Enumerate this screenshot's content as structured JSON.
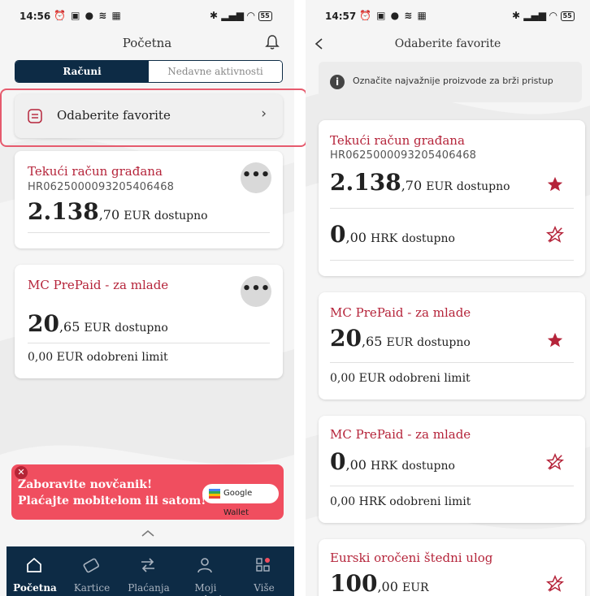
{
  "colors": {
    "brand_red": "#b5243a",
    "navy": "#0d2b45",
    "promo_red": "#f04e5f",
    "highlight": "#e65b6e"
  },
  "left": {
    "status": {
      "time": "14:56",
      "battery": "55"
    },
    "title": "Početna",
    "tabs": [
      {
        "label": "Računi",
        "active": true
      },
      {
        "label": "Nedavne aktivnosti",
        "active": false
      }
    ],
    "favorites_link": "Odaberite favorite",
    "accounts": [
      {
        "name": "Tekući račun građana",
        "iban": "HR0625000093205406468",
        "amount_big": "2.138",
        "amount_rest": ",70",
        "currency": "EUR",
        "status": "dostupno"
      },
      {
        "name": "MC PrePaid - za mlade",
        "amount_big": "20",
        "amount_rest": ",65",
        "currency": "EUR",
        "status": "dostupno",
        "limit": "0,00 EUR odobreni limit"
      }
    ],
    "more_icon": "•••",
    "promo": {
      "line1": "Zaboravite novčanik!",
      "line2": "Plaćajte mobitelom ili satom!",
      "wallet_label": "Google Wallet"
    },
    "nav": [
      {
        "label": "Početna",
        "icon": "home-icon",
        "active": true
      },
      {
        "label": "Kartice",
        "icon": "card-icon",
        "active": false
      },
      {
        "label": "Plaćanja",
        "icon": "transfer-icon",
        "active": false
      },
      {
        "label": "Moji podaci",
        "icon": "user-icon",
        "active": false
      },
      {
        "label": "Više",
        "icon": "grid-icon",
        "active": false
      }
    ]
  },
  "right": {
    "status": {
      "time": "14:57",
      "battery": "55"
    },
    "title": "Odaberite favorite",
    "info": "Označite najvažnije proizvode za brži pristup",
    "cards": [
      {
        "name": "Tekući račun građana",
        "iban": "HR0625000093205406468",
        "rows": [
          {
            "big": "2.138",
            "rest": ",70",
            "currency": "EUR",
            "status": "dostupno",
            "favorite": true
          },
          {
            "big": "0",
            "rest": ",00",
            "currency": "HRK",
            "status": "dostupno",
            "favorite": false
          }
        ]
      },
      {
        "name": "MC PrePaid - za mlade",
        "rows": [
          {
            "big": "20",
            "rest": ",65",
            "currency": "EUR",
            "status": "dostupno",
            "favorite": true
          }
        ],
        "limit": "0,00 EUR odobreni limit"
      },
      {
        "name": "MC PrePaid - za mlade",
        "rows": [
          {
            "big": "0",
            "rest": ",00",
            "currency": "HRK",
            "status": "dostupno",
            "favorite": false
          }
        ],
        "limit": "0,00 HRK odobreni limit"
      },
      {
        "name": "Eurski oročeni štedni ulog",
        "rows": [
          {
            "big": "100",
            "rest": ",00",
            "currency": "EUR",
            "status": "",
            "favorite": false
          }
        ]
      }
    ]
  }
}
